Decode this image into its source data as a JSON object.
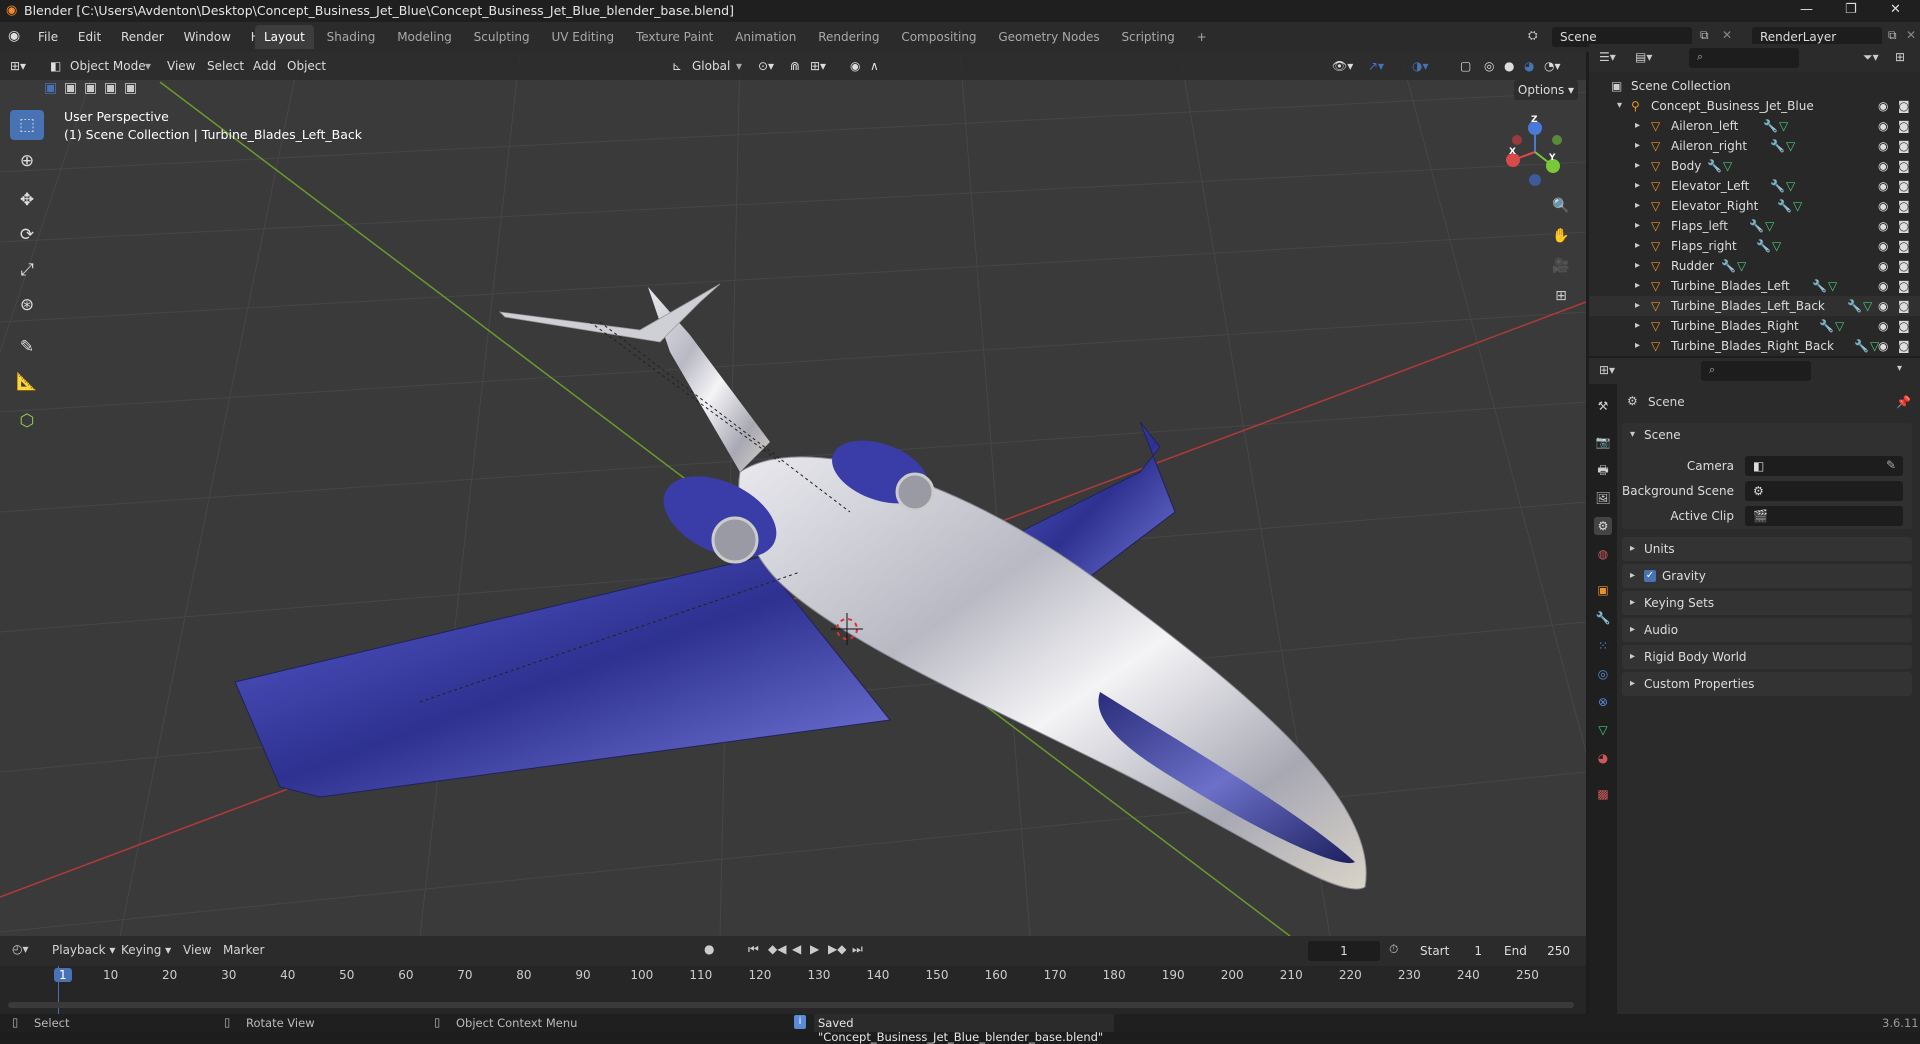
{
  "titlebar": {
    "title": "Blender [C:\\Users\\Avdenton\\Desktop\\Concept_Business_Jet_Blue\\Concept_Business_Jet_Blue_blender_base.blend]",
    "minimize": "—",
    "maximize": "❐",
    "close": "✕"
  },
  "menu": {
    "items": [
      "File",
      "Edit",
      "Render",
      "Window",
      "Help"
    ]
  },
  "workspaces": [
    "Layout",
    "Shading",
    "Modeling",
    "Sculpting",
    "UV Editing",
    "Texture Paint",
    "Animation",
    "Rendering",
    "Compositing",
    "Geometry Nodes",
    "Scripting",
    "+"
  ],
  "scene_field": "Scene",
  "renderlayer_field": "RenderLayer",
  "viewport_header": {
    "mode": "Object Mode",
    "view": "View",
    "select": "Select",
    "add": "Add",
    "object": "Object",
    "orientation": "Global",
    "options": "Options"
  },
  "viewport": {
    "perspective": "User Perspective",
    "collection_info": "(1) Scene Collection | Turbine_Blades_Left_Back"
  },
  "gizmo": {
    "x": "X",
    "y": "Y",
    "z": "Z"
  },
  "outliner": {
    "root": "Scene Collection",
    "collection": "Concept_Business_Jet_Blue",
    "objects": [
      "Aileron_left",
      "Aileron_right",
      "Body",
      "Elevator_Left",
      "Elevator_Right",
      "Flaps_left",
      "Flaps_right",
      "Rudder",
      "Turbine_Blades_Left",
      "Turbine_Blades_Left_Back",
      "Turbine_Blades_Right",
      "Turbine_Blades_Right_Back"
    ],
    "selected": "Turbine_Blades_Left_Back"
  },
  "properties": {
    "context": "Scene",
    "panel": "Scene",
    "fields": {
      "camera": "Camera",
      "background_scene": "Background Scene",
      "active_clip": "Active Clip"
    },
    "sections": [
      "Units",
      "Gravity",
      "Keying Sets",
      "Audio",
      "Rigid Body World",
      "Custom Properties"
    ],
    "gravity_checked": true
  },
  "timeline": {
    "menus": [
      "Playback",
      "Keying",
      "View",
      "Marker"
    ],
    "current_frame": "1",
    "start_label": "Start",
    "start": "1",
    "end_label": "End",
    "end": "250",
    "ticks": [
      "1",
      "10",
      "20",
      "30",
      "40",
      "50",
      "60",
      "70",
      "80",
      "90",
      "100",
      "110",
      "120",
      "130",
      "140",
      "150",
      "160",
      "170",
      "180",
      "190",
      "200",
      "210",
      "220",
      "230",
      "240",
      "250"
    ]
  },
  "status": {
    "select": "Select",
    "rotate": "Rotate View",
    "context_menu": "Object Context Menu",
    "message": "Saved \"Concept_Business_Jet_Blue_blender_base.blend\"",
    "version": "3.6.11"
  },
  "colors": {
    "accent": "#4772b3",
    "grid": "#4a4a4a",
    "x_axis": "#b03a3a",
    "y_axis": "#6a9a2a",
    "jet_blue": "#3b3fa8",
    "orange_icon": "#e8922a",
    "status_icon": "#5a8ad8"
  }
}
